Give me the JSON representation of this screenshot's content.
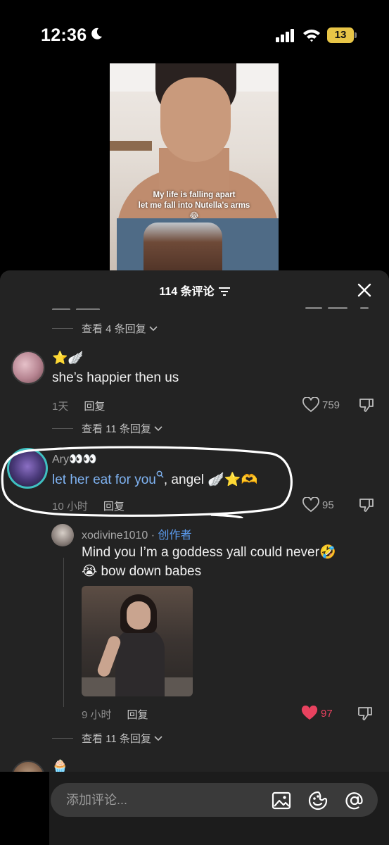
{
  "status_bar": {
    "time": "12:36",
    "battery": "13"
  },
  "video": {
    "caption_line1": "My life is falling apart",
    "caption_line2": "let me fall into Nutella's arms",
    "caption_emoji": "😂"
  },
  "comments_header": {
    "title": "114 条评论"
  },
  "thread0": {
    "view_replies": "查看 4 条回复"
  },
  "comment1": {
    "badges": "⭐🪽",
    "text": "she’s happier then us",
    "time": "1天",
    "reply": "回复",
    "likes": "759",
    "view_replies": "查看 11 条回复"
  },
  "comment2": {
    "username": "Ary👀👀",
    "link_text": "let her eat for you",
    "text_rest": ", angel 🪽⭐🫶",
    "time": "10 小时",
    "reply": "回复",
    "likes": "95"
  },
  "reply1": {
    "username": "xodivine1010",
    "separator": " · ",
    "creator_label": "创作者",
    "text_line1": "Mind you I’m a goddess yall could never🤣",
    "text_line2": "😭 bow down babes",
    "time": "9 小时",
    "reply": "回复",
    "likes": "97",
    "view_replies": "查看 11 条回复"
  },
  "comment3": {
    "badges": "🧁"
  },
  "input": {
    "placeholder": "添加评论..."
  },
  "colors": {
    "sheet_bg": "#232323",
    "link": "#7fb3f2",
    "creator": "#5b9cf0",
    "liked_heart": "#e8425f"
  }
}
